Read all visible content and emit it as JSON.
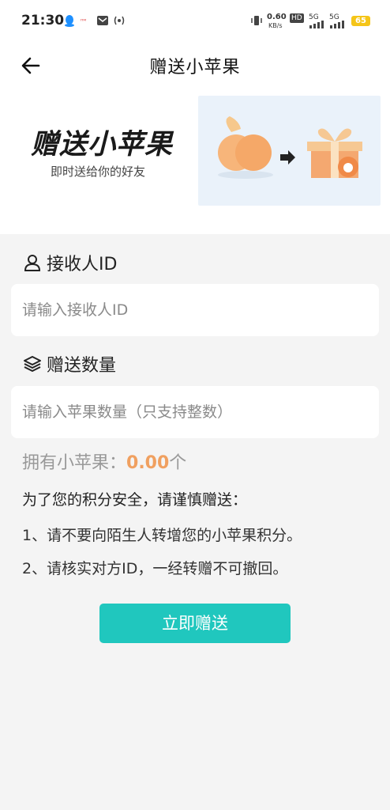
{
  "status_bar": {
    "time": "21:30",
    "net_speed": "0.60",
    "net_unit": "KB/s",
    "hd": "HD",
    "sim1": "5G",
    "sim2": "5G",
    "battery": "65",
    "icons": [
      "qq-icon",
      "notification-icon",
      "mail-icon",
      "nfc-icon",
      "vibrate-icon",
      "signal-icon",
      "battery-icon"
    ]
  },
  "header": {
    "title": "赠送小苹果"
  },
  "banner": {
    "title": "赠送小苹果",
    "subtitle": "即时送给你的好友"
  },
  "form": {
    "recipient_label": "接收人ID",
    "recipient_placeholder": "请输入接收人ID",
    "quantity_label": "赠送数量",
    "quantity_placeholder": "请输入苹果数量（只支持整数）"
  },
  "balance": {
    "prefix": "拥有小苹果：",
    "amount": "0.00",
    "unit": "个"
  },
  "notice": {
    "title": "为了您的积分安全，请谨慎赠送：",
    "items": [
      "1、请不要向陌生人转增您的小苹果积分。",
      "2、请核实对方ID，一经转赠不可撤回。"
    ]
  },
  "submit_label": "立即赠送",
  "colors": {
    "accent": "#20c7be",
    "amount": "#f0a060",
    "background": "#f4f4f4"
  }
}
